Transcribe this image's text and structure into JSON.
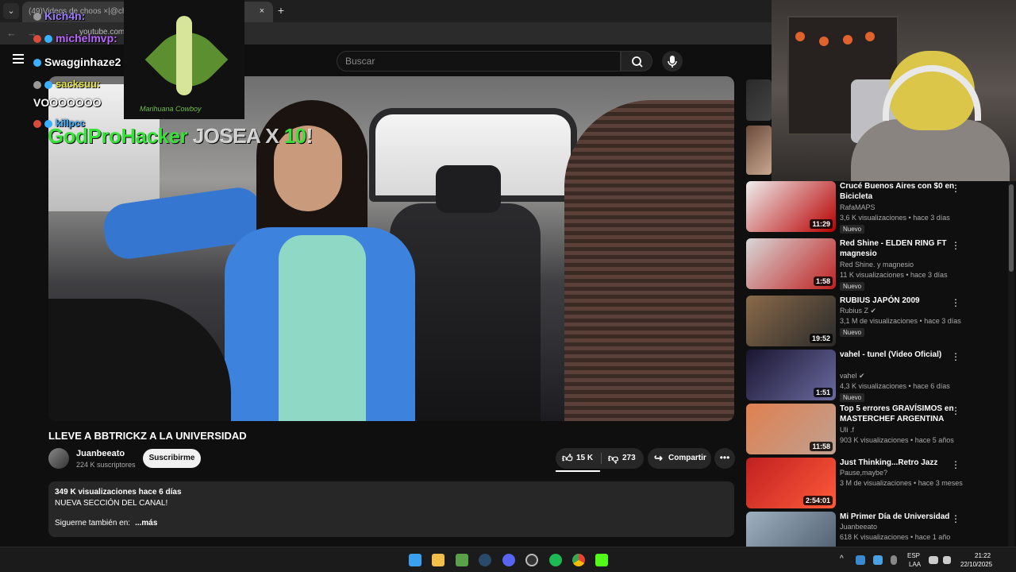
{
  "browser": {
    "tab_list": "⌄",
    "tab_title": "(49)Videos de choos ×|@cho-",
    "tab_close": "×",
    "new_tab": "+",
    "url": "youtube.com"
  },
  "youtube": {
    "search_placeholder": "Buscar"
  },
  "overlay": {
    "chat": [
      {
        "user": "Kich4n:",
        "color": "#9f7bff"
      },
      {
        "user": "michelmvp:",
        "color": "#bb66ff"
      },
      {
        "user": "Swagginhaze2",
        "color": "#ffffff"
      },
      {
        "user": "sacksuu:",
        "color": "#e6e64a"
      },
      {
        "user": "VOOOOOOO",
        "color": "#ffffff"
      },
      {
        "user": "killpcc",
        "color": "#3ab0ff"
      }
    ],
    "emote_caption": "Marihuana Cowboy",
    "banner_green": "GodProHacker",
    "banner_white": "JOSEA X",
    "banner_num": "10",
    "banner_end": "!"
  },
  "video": {
    "title": "LLEVE A BBTRICKZ A LA UNIVERSIDAD",
    "channel": "Juanbeeato",
    "subscribers": "224 K suscriptores",
    "subscribe_label": "Suscribirme",
    "likes": "15 K",
    "dislikes": "273",
    "share_label": "Compartir",
    "more_label": "•••",
    "description": {
      "stats": "349 K visualizaciones  hace 6 días",
      "line1": "NUEVA SECCIÓN DEL CANAL!",
      "follow": "Siguerne también en:",
      "more": "...más"
    }
  },
  "recommendations": [
    {
      "title": "Crucé Buenos Aires con $0 en Bicicleta",
      "channel": "RafaMAPS",
      "stats": "3,6 K visualizaciones • hace 3 días",
      "badge": "Nuevo",
      "duration": "11:29",
      "thumb": "linear-gradient(135deg,#eeeeee,#b80000)"
    },
    {
      "title": "Red Shine - ELDEN RING FT magnesio",
      "channel": "Red Shine. y magnesio",
      "stats": "11 K visualizaciones • hace 3 días",
      "badge": "Nuevo",
      "duration": "1:58",
      "thumb": "linear-gradient(135deg,#d8d8d8,#c02020)"
    },
    {
      "title": "RUBIUS JAPÓN 2009",
      "channel": "Rubius Z ✔",
      "stats": "3,1 M de visualizaciones • hace 3 días",
      "badge": "Nuevo",
      "duration": "19:52",
      "thumb": "linear-gradient(135deg,#8a6a4a,#2a2a2a)"
    },
    {
      "title": "vahel - tunel (Video Oficial)",
      "channel": "vahel ✔",
      "stats": "4,3 K visualizaciones • hace 6 días",
      "badge": "Nuevo",
      "duration": "1:51",
      "thumb": "linear-gradient(135deg,#1a1530,#6a6aa0)"
    },
    {
      "title": "Top 5 errores GRAVÍSIMOS en MASTERCHEF ARGENTINA",
      "channel": "Uli .f",
      "stats": "903 K visualizaciones • hace 5 años",
      "badge": "",
      "duration": "11:58",
      "thumb": "linear-gradient(135deg,#e08050,#c0a090)"
    },
    {
      "title": "Just Thinking...Retro Jazz",
      "channel": "Pause,maybe?",
      "stats": "3 M de visualizaciones • hace 3 meses",
      "badge": "",
      "duration": "2:54:01",
      "thumb": "linear-gradient(135deg,#c02020,#ff5a3a)"
    },
    {
      "title": "Mi Primer Día de Universidad",
      "channel": "Juanbeeato",
      "stats": "618 K visualizaciones • hace 1 año",
      "badge": "",
      "duration": "",
      "thumb": "linear-gradient(135deg,#9fb0c0,#4a5a6a)"
    }
  ],
  "taskbar": {
    "lang1": "ESP",
    "lang2": "LAA",
    "time": "21:22",
    "date": "22/10/2025",
    "icons": [
      "windows-icon",
      "file-explorer-icon",
      "app-icon",
      "steam-icon",
      "discord-icon",
      "obs-icon",
      "spotify-icon",
      "chrome-icon",
      "kick-icon"
    ]
  }
}
